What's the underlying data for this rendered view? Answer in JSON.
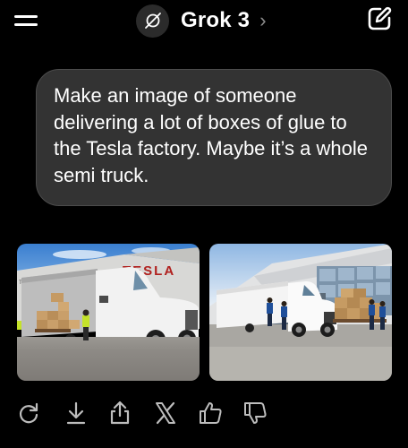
{
  "header": {
    "model_name": "Grok 3",
    "chevron": "›"
  },
  "message": {
    "text": "Make an image of someone delivering a lot of boxes of glue to the Tesla factory. Maybe it’s a whole semi truck."
  },
  "images": [
    {
      "factory_sign": "TESLA",
      "wall_sign": "TESLA"
    },
    {
      "factory_sign": ""
    }
  ],
  "actions": [
    {
      "icon": "regenerate-icon"
    },
    {
      "icon": "download-icon"
    },
    {
      "icon": "share-icon"
    },
    {
      "icon": "x-logo-icon"
    },
    {
      "icon": "thumbs-up-icon"
    },
    {
      "icon": "thumbs-down-icon"
    }
  ],
  "colors": {
    "background": "#000000",
    "bubble": "#333333",
    "bubble_border": "#4c4c4c",
    "icon": "#bdbdbd",
    "logo_bg": "#2b2b2b"
  }
}
